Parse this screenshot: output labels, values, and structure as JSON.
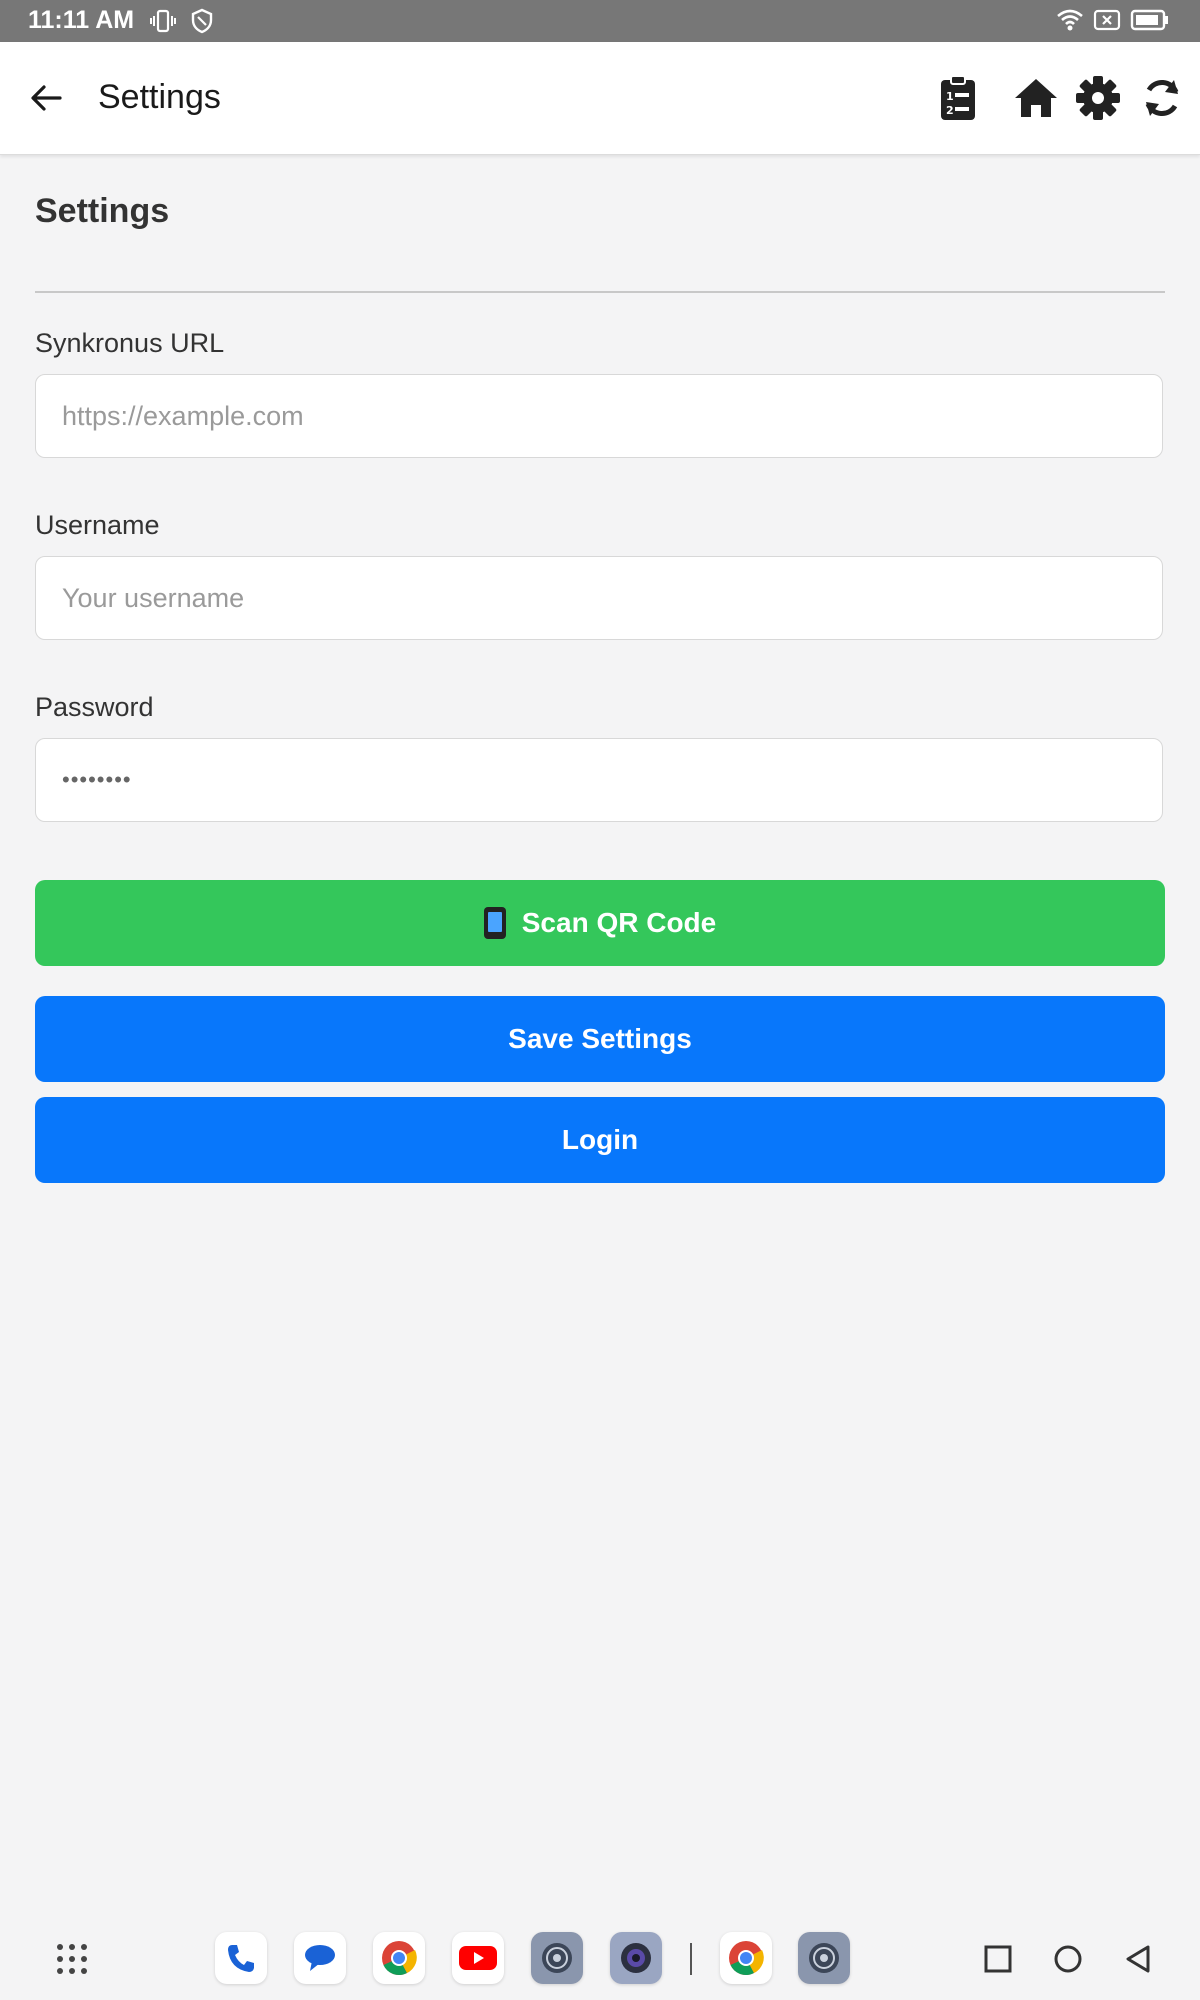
{
  "status_bar": {
    "time": "11:11 AM",
    "icons": [
      "vibrate-icon",
      "shield-icon",
      "wifi-icon",
      "sim-x-icon",
      "battery-icon"
    ]
  },
  "app_bar": {
    "title": "Settings",
    "actions": [
      "clipboard-list-icon",
      "home-icon",
      "gear-icon",
      "sync-icon"
    ]
  },
  "page": {
    "heading": "Settings",
    "url_label": "Synkronus URL",
    "url_placeholder": "https://example.com",
    "username_label": "Username",
    "username_placeholder": "Your username",
    "password_label": "Password",
    "password_value": "••••••••",
    "scan_button": "Scan QR Code",
    "save_button": "Save Settings",
    "login_button": "Login"
  },
  "colors": {
    "scan_button": "#34c75b",
    "primary_button": "#0877fb",
    "status_bar": "#777777"
  },
  "nav_bar": {
    "dock": [
      "app-drawer-icon",
      "phone-app-icon",
      "messages-app-icon",
      "chrome-app-icon",
      "youtube-app-icon",
      "settings-app-icon",
      "camera-app-icon",
      "chrome-app-icon",
      "settings-app-icon"
    ],
    "system_buttons": [
      "recents-button",
      "home-button",
      "back-button"
    ]
  }
}
